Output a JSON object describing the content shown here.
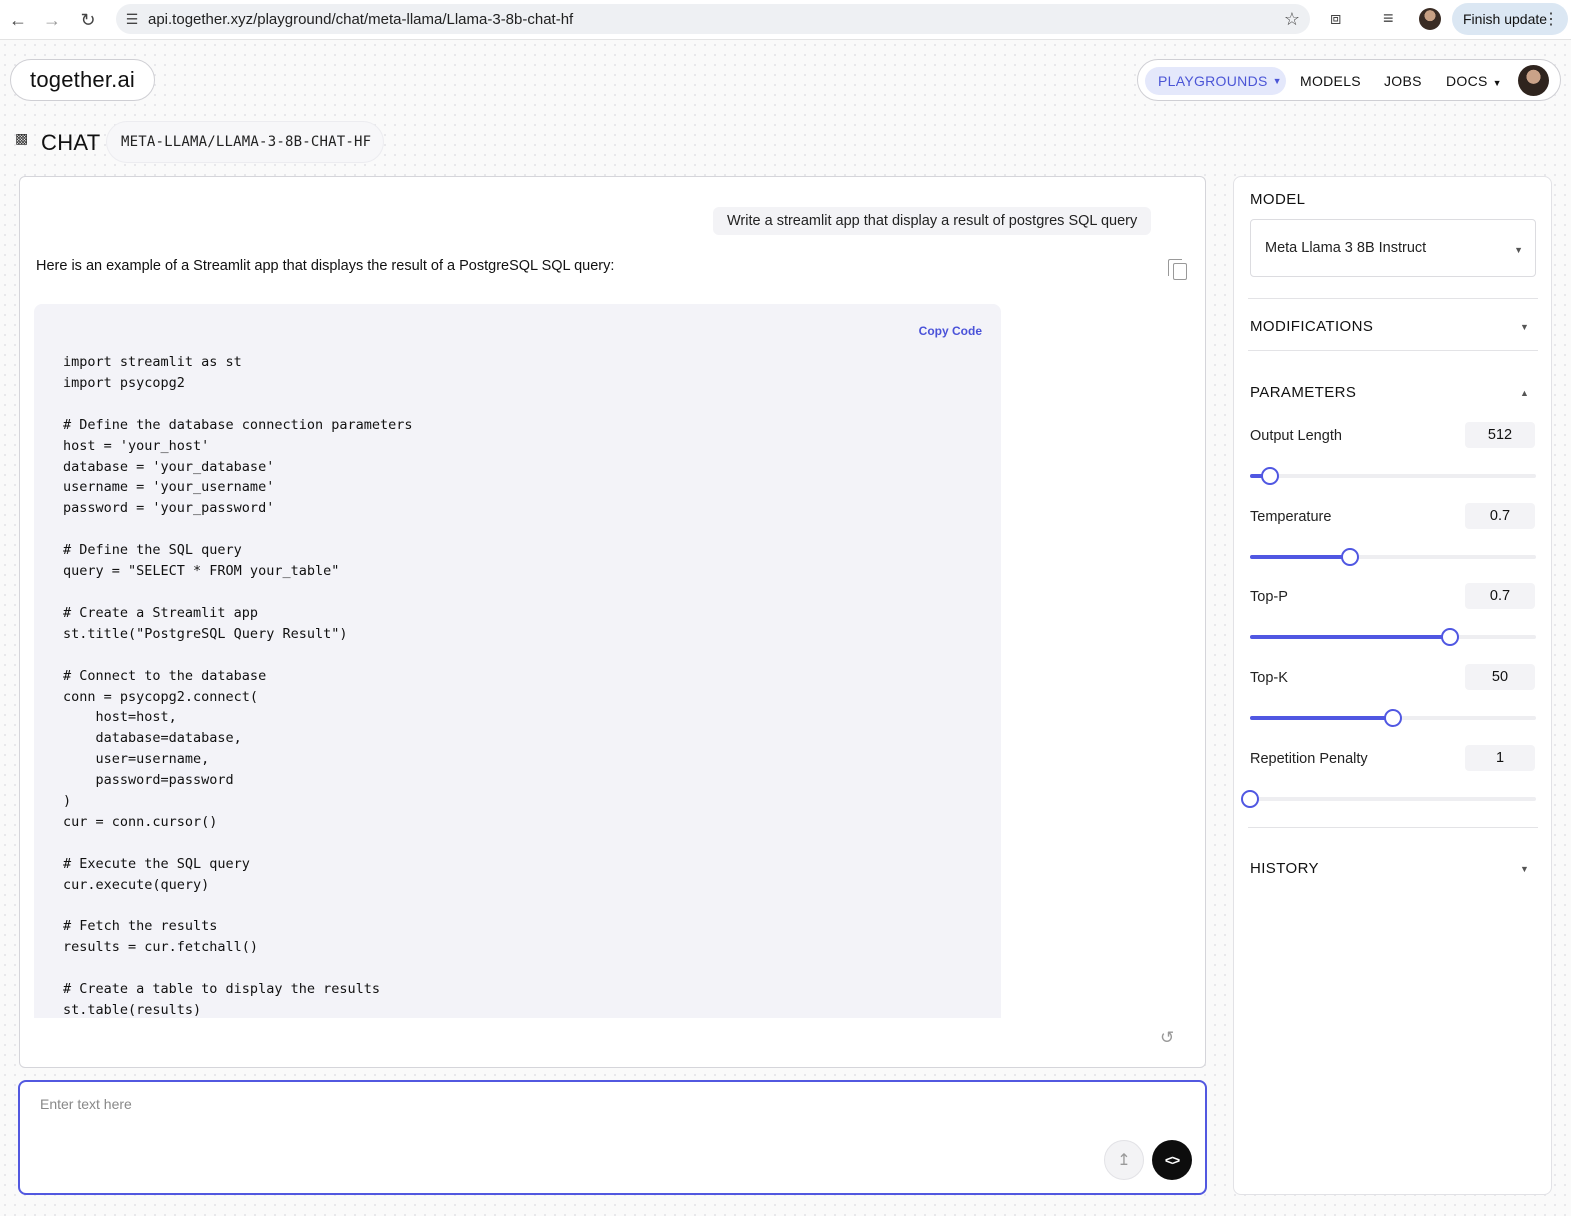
{
  "browser": {
    "url": "api.together.xyz/playground/chat/meta-llama/Llama-3-8b-chat-hf",
    "finish_update": "Finish update"
  },
  "header": {
    "brand": "together.ai",
    "nav": {
      "playgrounds": "PLAYGROUNDS",
      "models": "MODELS",
      "jobs": "JOBS",
      "docs": "DOCS"
    }
  },
  "page": {
    "title": "CHAT",
    "model_badge": "META-LLAMA/LLAMA-3-8B-CHAT-HF"
  },
  "chat": {
    "user_message": "Write a streamlit app that display a result of postgres SQL query",
    "assistant_intro": "Here is an example of a Streamlit app that displays the result of a PostgreSQL SQL query:",
    "copy_code_label": "Copy Code",
    "code": "import streamlit as st\nimport psycopg2\n\n# Define the database connection parameters\nhost = 'your_host'\ndatabase = 'your_database'\nusername = 'your_username'\npassword = 'your_password'\n\n# Define the SQL query\nquery = \"SELECT * FROM your_table\"\n\n# Create a Streamlit app\nst.title(\"PostgreSQL Query Result\")\n\n# Connect to the database\nconn = psycopg2.connect(\n    host=host,\n    database=database,\n    user=username,\n    password=password\n)\ncur = conn.cursor()\n\n# Execute the SQL query\ncur.execute(query)\n\n# Fetch the results\nresults = cur.fetchall()\n\n# Create a table to display the results\nst.table(results)"
  },
  "input": {
    "placeholder": "Enter text here",
    "value": ""
  },
  "sidebar": {
    "model_title": "MODEL",
    "model_value": "Meta Llama 3 8B Instruct",
    "modifications_title": "MODIFICATIONS",
    "parameters_title": "PARAMETERS",
    "history_title": "HISTORY",
    "params": [
      {
        "label": "Output Length",
        "value": "512",
        "fraction": 0.07
      },
      {
        "label": "Temperature",
        "value": "0.7",
        "fraction": 0.35
      },
      {
        "label": "Top-P",
        "value": "0.7",
        "fraction": 0.7
      },
      {
        "label": "Top-K",
        "value": "50",
        "fraction": 0.5
      },
      {
        "label": "Repetition Penalty",
        "value": "1",
        "fraction": 0.0
      }
    ]
  },
  "colors": {
    "accent": "#5057e2",
    "nav_active_bg": "#e4e8fb"
  }
}
